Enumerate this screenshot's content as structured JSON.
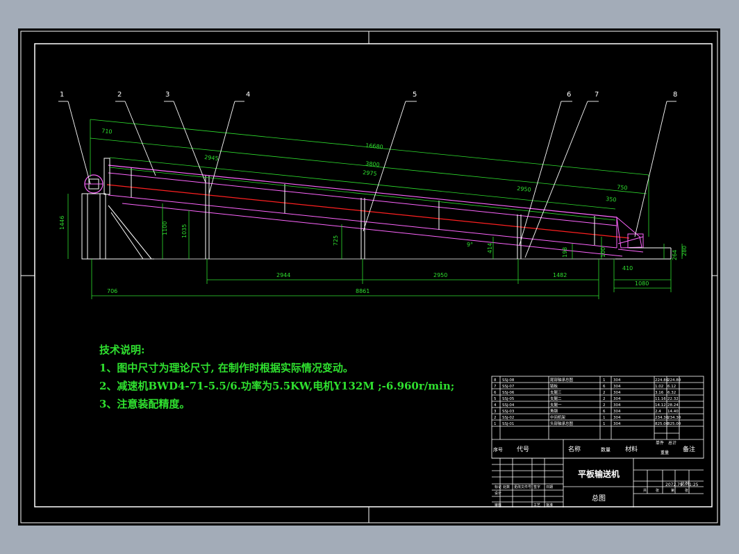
{
  "drawing": {
    "callouts": [
      "1",
      "2",
      "3",
      "4",
      "5",
      "6",
      "7",
      "8"
    ],
    "dimensions": {
      "top_chain": [
        "710",
        "16680",
        "3800",
        "2945",
        "2975",
        "2950",
        "750",
        "350"
      ],
      "heights": [
        "1446",
        "1100",
        "1035",
        "725",
        "414",
        "198",
        "100",
        "280",
        "264"
      ],
      "bottom_chain": [
        "2944",
        "2950",
        "1482"
      ],
      "overall": [
        "706",
        "8861",
        "410",
        "1080"
      ],
      "angle": "9°"
    }
  },
  "technical_notes": {
    "heading": "技术说明:",
    "items": [
      "1、图中尺寸为理论尺寸, 在制作时根据实际情况变动。",
      "2、减速机BWD4-71-5.5/6.功率为5.5KW,电机Y132M    ;-6.960r/min;",
      "3、注意装配精度。"
    ]
  },
  "bom": {
    "rows": [
      {
        "no": "8",
        "code": "SSJ-08",
        "name": "尾部轴承总图",
        "qty": "1",
        "mat": "304",
        "w1": "224.80",
        "w2": "224.80"
      },
      {
        "no": "7",
        "code": "SSJ-07",
        "name": "链板",
        "qty": "6",
        "mat": "304",
        "w1": "1.02",
        "w2": "6.12"
      },
      {
        "no": "6",
        "code": "SSJ-06",
        "name": "支腿三",
        "qty": "2",
        "mat": "304",
        "w1": "3.16",
        "w2": "6.32"
      },
      {
        "no": "5",
        "code": "SSJ-05",
        "name": "支腿二",
        "qty": "2",
        "mat": "304",
        "w1": "11.16",
        "w2": "22.32"
      },
      {
        "no": "4",
        "code": "SSJ-04",
        "name": "支腿一",
        "qty": "2",
        "mat": "304",
        "w1": "14.12",
        "w2": "28.24"
      },
      {
        "no": "3",
        "code": "SSJ-03",
        "name": "角钢",
        "qty": "6",
        "mat": "304",
        "w1": "2.4",
        "w2": "14.40"
      },
      {
        "no": "2",
        "code": "SSJ-02",
        "name": "中间机架",
        "qty": "1",
        "mat": "304",
        "w1": "234.30",
        "w2": "234.30"
      },
      {
        "no": "1",
        "code": "SSJ-01",
        "name": "头部轴承总图",
        "qty": "1",
        "mat": "304",
        "w1": "825.00",
        "w2": "825.00"
      }
    ],
    "headers": {
      "no": "序号",
      "code": "代号",
      "name": "名称",
      "qty": "数量",
      "mat": "材料",
      "single": "单件",
      "total": "总计",
      "weight": "重量",
      "remark": "备注"
    }
  },
  "title_block": {
    "title": "平板输送机",
    "subtitle": "总图",
    "scale_label": "比例",
    "scale": "1:25",
    "weight": "2072.79",
    "labels": [
      "标记",
      "处数",
      "更改文件号",
      "签字",
      "日期",
      "设计",
      "审核",
      "工艺",
      "批准",
      "共",
      "张",
      "第",
      "张"
    ]
  },
  "colors": {
    "frame": "#ffffff",
    "outline": "#ff66ff",
    "conveyor_line": "#ff2020",
    "dimension": "#2fe02f",
    "annotation": "#ffffff",
    "notes": "#2fe02f",
    "background": "#000000"
  }
}
